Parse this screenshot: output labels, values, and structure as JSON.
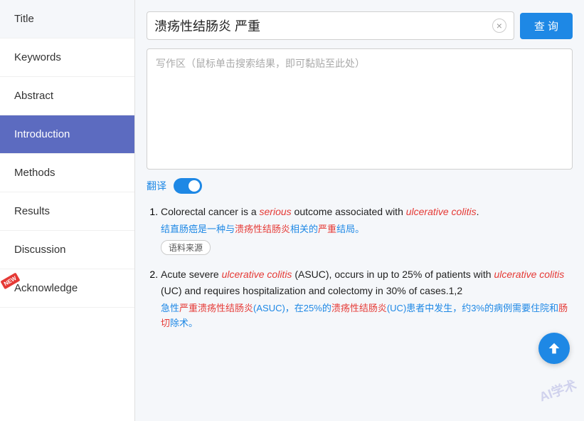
{
  "sidebar": {
    "items": [
      {
        "id": "title",
        "label": "Title",
        "active": false,
        "new": false
      },
      {
        "id": "keywords",
        "label": "Keywords",
        "active": false,
        "new": false
      },
      {
        "id": "abstract",
        "label": "Abstract",
        "active": false,
        "new": false
      },
      {
        "id": "introduction",
        "label": "Introduction",
        "active": true,
        "new": false
      },
      {
        "id": "methods",
        "label": "Methods",
        "active": false,
        "new": false
      },
      {
        "id": "results",
        "label": "Results",
        "active": false,
        "new": false
      },
      {
        "id": "discussion",
        "label": "Discussion",
        "active": false,
        "new": false
      },
      {
        "id": "acknowledge",
        "label": "Acknowledge",
        "active": false,
        "new": true
      }
    ]
  },
  "search": {
    "query": "溃疡性结肠炎 严重",
    "clear_label": "×",
    "query_button": "查 询",
    "writing_placeholder": "写作区（鼠标单击搜索结果，即可黏贴至此处）"
  },
  "translate": {
    "label": "翻译"
  },
  "results": [
    {
      "id": 1,
      "en_parts": [
        {
          "text": "Colorectal cancer is a ",
          "type": "normal"
        },
        {
          "text": "serious",
          "type": "italic-red"
        },
        {
          "text": " outcome associated with ",
          "type": "normal"
        },
        {
          "text": "ulcerative colitis",
          "type": "italic-blue"
        },
        {
          "text": ".",
          "type": "normal"
        }
      ],
      "cn": "结直肠癌是一种与溃疡性结肠炎相关的严重结局。",
      "cn_highlights": [
        "溃疡性结肠炎",
        "严重"
      ],
      "source": "语料来源"
    },
    {
      "id": 2,
      "en_parts": [
        {
          "text": "Acute severe ",
          "type": "normal"
        },
        {
          "text": "ulcerative colitis",
          "type": "italic-blue"
        },
        {
          "text": " (ASUC), occurs in up to 25% of patients with ",
          "type": "normal"
        },
        {
          "text": "ulcerative colitis",
          "type": "italic-blue"
        },
        {
          "text": " (UC) and requires hospitalization and colectomy in 30% of cases.1,2",
          "type": "normal"
        }
      ],
      "cn": "急性严重溃疡性结肠炎(ASUC)，在25%的溃疡性结肠炎(UC)患者中发生，约3%的病例需要住院和肠切除术。",
      "cn_highlights": [
        "严重溃疡性结肠炎",
        "溃疡性结肠炎",
        "肠切"
      ]
    }
  ],
  "watermark": "AI学术",
  "scroll_up_label": "↑"
}
